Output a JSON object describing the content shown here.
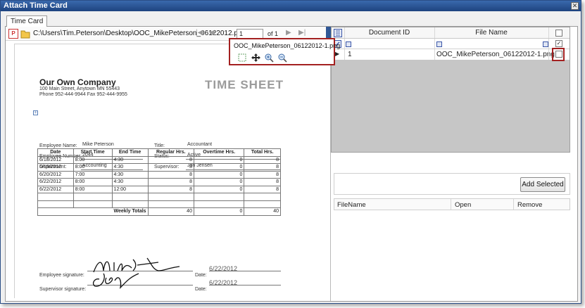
{
  "window": {
    "title": "Attach Time Card",
    "close_glyph": "✕"
  },
  "tab": {
    "label": "Time Card"
  },
  "viewer": {
    "file_path": "C:\\Users\\Tim.Peterson\\Desktop\\OOC_MikePeterson_06122012.pdf",
    "nav": {
      "first": "|◀",
      "prev": "◀",
      "next": "▶",
      "last": "▶|"
    },
    "page_current": "1",
    "page_of": "of 1",
    "popup_filename": "OOC_MikePeterson_06122012-1.png",
    "popup_tools": [
      "select-icon",
      "pan-icon",
      "zoom-in-icon",
      "zoom-out-icon"
    ]
  },
  "sheet": {
    "company": "Our Own Company",
    "address": "100 Main Street, Anytown MN 55443",
    "phone": "Phone 952-444-9944     Fax 952-444-9955",
    "title": "TIME SHEET",
    "fields": {
      "employee_name_label": "Employee Name:",
      "employee_name": "Mike Peterson",
      "title_label": "Title:",
      "title": "Accountant",
      "employee_number_label": "Employee Number:",
      "employee_number": "2044",
      "status_label": "Status:",
      "status": "Active",
      "department_label": "Department:",
      "department": "Accounting",
      "supervisor_label": "Supervisor:",
      "supervisor": "Jon Jensen"
    },
    "table": {
      "headers": [
        "Date",
        "Start Time",
        "End Time",
        "Regular Hrs.",
        "Overtime Hrs.",
        "Total Hrs."
      ],
      "rows": [
        [
          "6/18/2012",
          "8:00",
          "4:30",
          "8",
          "0",
          "8"
        ],
        [
          "6/19/2012",
          "8:00",
          "4:30",
          "8",
          "0",
          "8"
        ],
        [
          "6/20/2012",
          "7:00",
          "4:30",
          "8",
          "0",
          "8"
        ],
        [
          "6/22/2012",
          "8:00",
          "4:30",
          "8",
          "0",
          "8"
        ],
        [
          "6/22/2012",
          "8:00",
          "12:00",
          "8",
          "0",
          "8"
        ]
      ],
      "totals_label": "Weekly Totals",
      "totals": [
        "40",
        "0",
        "40"
      ]
    },
    "signatures": {
      "employee_label": "Employee signature:",
      "supervisor_label": "Supervisor signature:",
      "date_label": "Date:",
      "employee_date": "6/22/2012",
      "supervisor_date": "6/22/2012"
    }
  },
  "grid": {
    "headers": {
      "document_id": "Document ID",
      "file_name": "File Name"
    },
    "row": {
      "id": "1",
      "file_name": "OOC_MikePeterson_06122012-1.png"
    }
  },
  "attachments": {
    "add_selected": "Add Selected",
    "headers": {
      "filename": "FileName",
      "open": "Open",
      "remove": "Remove"
    }
  }
}
